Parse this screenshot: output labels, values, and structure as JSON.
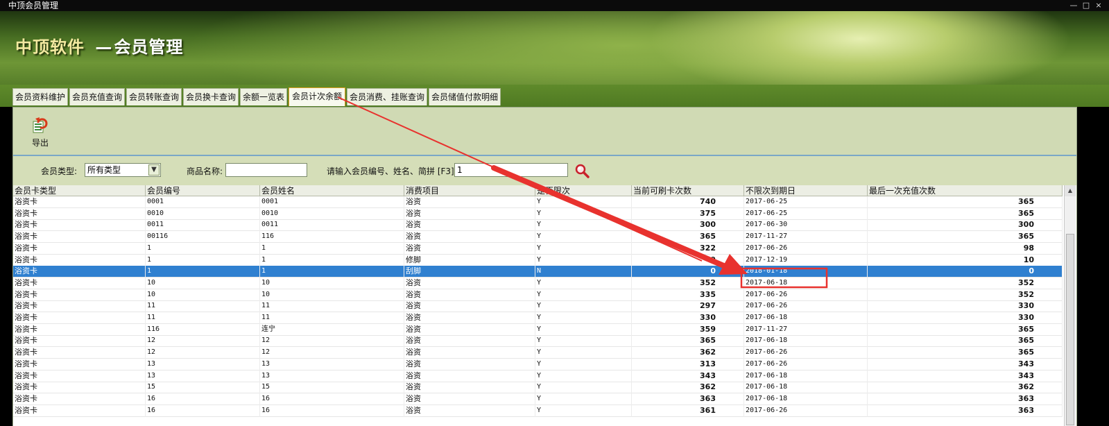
{
  "window": {
    "title": "中顶会员管理",
    "minimize": "—",
    "restore": "□",
    "close": "×"
  },
  "banner": {
    "brand": "中顶软件",
    "sep": "—",
    "subtitle": "会员管理"
  },
  "tabs": [
    {
      "label": "会员资料维护"
    },
    {
      "label": "会员充值查询"
    },
    {
      "label": "会员转账查询"
    },
    {
      "label": "会员换卡查询"
    },
    {
      "label": "余额一览表"
    },
    {
      "label": "会员计次余额",
      "active": true
    },
    {
      "label": "会员消费、挂账查询"
    },
    {
      "label": "会员储值付款明细"
    }
  ],
  "toolbar": {
    "export_label": "导出",
    "export_icon": "excel-export-icon"
  },
  "filter": {
    "member_type_label": "会员类型:",
    "member_type_value": "所有类型",
    "product_label": "商品名称:",
    "product_value": "",
    "search_label": "请输入会员编号、姓名、简拼 [F3]",
    "search_value": "1",
    "search_icon": "magnifier-icon"
  },
  "table": {
    "columns": [
      "会员卡类型",
      "会员编号",
      "会员姓名",
      "消费项目",
      "是否限次",
      "当前可刷卡次数",
      "不限次到期日",
      "最后一次充值次数"
    ],
    "rows": [
      [
        "浴资卡",
        "0001",
        "0001",
        "浴资",
        "Y",
        "740",
        "2017-06-25",
        "365"
      ],
      [
        "浴资卡",
        "0010",
        "0010",
        "浴资",
        "Y",
        "375",
        "2017-06-25",
        "365"
      ],
      [
        "浴资卡",
        "0011",
        "0011",
        "浴资",
        "Y",
        "300",
        "2017-06-30",
        "300"
      ],
      [
        "浴资卡",
        "00116",
        "116",
        "浴资",
        "Y",
        "365",
        "2017-11-27",
        "365"
      ],
      [
        "浴资卡",
        "1",
        "1",
        "浴资",
        "Y",
        "322",
        "2017-06-26",
        "98"
      ],
      [
        "浴资卡",
        "1",
        "1",
        "修脚",
        "Y",
        "9",
        "2017-12-19",
        "10"
      ],
      [
        "浴资卡",
        "1",
        "1",
        "刮脚",
        "N",
        "0",
        "2018-01-18",
        "0"
      ],
      [
        "浴资卡",
        "10",
        "10",
        "浴资",
        "Y",
        "352",
        "2017-06-18",
        "352"
      ],
      [
        "浴资卡",
        "10",
        "10",
        "浴资",
        "Y",
        "335",
        "2017-06-26",
        "352"
      ],
      [
        "浴资卡",
        "11",
        "11",
        "浴资",
        "Y",
        "297",
        "2017-06-26",
        "330"
      ],
      [
        "浴资卡",
        "11",
        "11",
        "浴资",
        "Y",
        "330",
        "2017-06-18",
        "330"
      ],
      [
        "浴资卡",
        "116",
        "连宁",
        "浴资",
        "Y",
        "359",
        "2017-11-27",
        "365"
      ],
      [
        "浴资卡",
        "12",
        "12",
        "浴资",
        "Y",
        "365",
        "2017-06-18",
        "365"
      ],
      [
        "浴资卡",
        "12",
        "12",
        "浴资",
        "Y",
        "362",
        "2017-06-26",
        "365"
      ],
      [
        "浴资卡",
        "13",
        "13",
        "浴资",
        "Y",
        "313",
        "2017-06-26",
        "343"
      ],
      [
        "浴资卡",
        "13",
        "13",
        "浴资",
        "Y",
        "343",
        "2017-06-18",
        "343"
      ],
      [
        "浴资卡",
        "15",
        "15",
        "浴资",
        "Y",
        "362",
        "2017-06-18",
        "362"
      ],
      [
        "浴资卡",
        "16",
        "16",
        "浴资",
        "Y",
        "363",
        "2017-06-18",
        "363"
      ],
      [
        "浴资卡",
        "16",
        "16",
        "浴资",
        "Y",
        "361",
        "2017-06-26",
        "363"
      ]
    ],
    "selected_row": 6
  },
  "colors": {
    "accent_selection": "#2f80d0",
    "annotation_red": "#e8322e",
    "tab_active_border": "#e0a020"
  }
}
